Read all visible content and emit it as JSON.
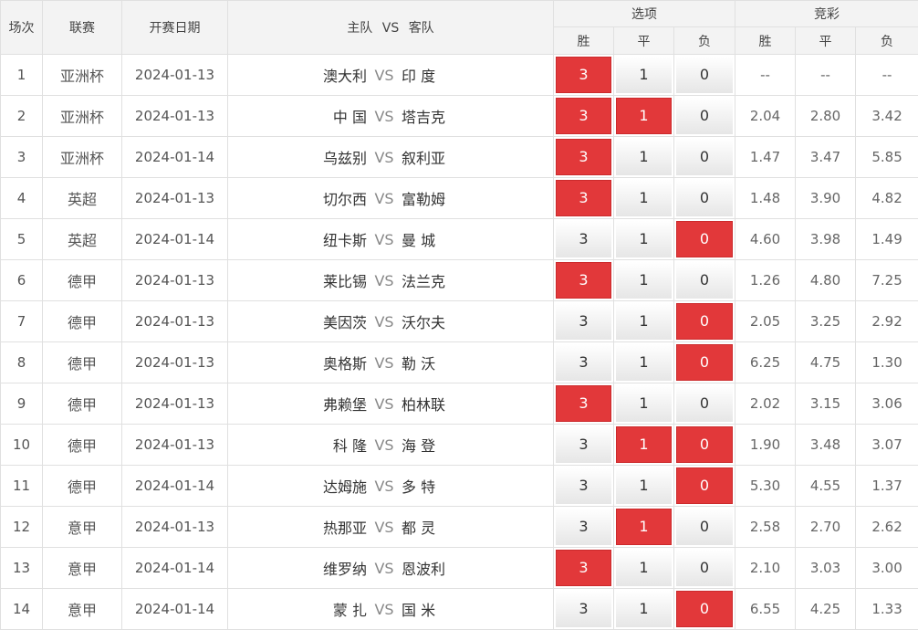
{
  "headers": {
    "round": "场次",
    "league": "联赛",
    "date": "开赛日期",
    "home": "主队",
    "vs": "VS",
    "away": "客队",
    "options": "选项",
    "lottery": "竞彩",
    "win": "胜",
    "draw": "平",
    "loss": "负"
  },
  "option_values": {
    "win": "3",
    "draw": "1",
    "loss": "0"
  },
  "colors": {
    "selected": "#e2383a",
    "header_bg": "#f3f3f3",
    "border": "#e0e0e0"
  },
  "rows": [
    {
      "no": "1",
      "league": "亚洲杯",
      "date": "2024-01-13",
      "home": "澳大利",
      "away": "印 度",
      "sel_win": true,
      "sel_draw": false,
      "sel_loss": false,
      "odds": [
        "--",
        "--",
        "--"
      ]
    },
    {
      "no": "2",
      "league": "亚洲杯",
      "date": "2024-01-13",
      "home": "中 国",
      "away": "塔吉克",
      "sel_win": true,
      "sel_draw": true,
      "sel_loss": false,
      "odds": [
        "2.04",
        "2.80",
        "3.42"
      ]
    },
    {
      "no": "3",
      "league": "亚洲杯",
      "date": "2024-01-14",
      "home": "乌兹别",
      "away": "叙利亚",
      "sel_win": true,
      "sel_draw": false,
      "sel_loss": false,
      "odds": [
        "1.47",
        "3.47",
        "5.85"
      ]
    },
    {
      "no": "4",
      "league": "英超",
      "date": "2024-01-13",
      "home": "切尔西",
      "away": "富勒姆",
      "sel_win": true,
      "sel_draw": false,
      "sel_loss": false,
      "odds": [
        "1.48",
        "3.90",
        "4.82"
      ]
    },
    {
      "no": "5",
      "league": "英超",
      "date": "2024-01-14",
      "home": "纽卡斯",
      "away": "曼 城",
      "sel_win": false,
      "sel_draw": false,
      "sel_loss": true,
      "odds": [
        "4.60",
        "3.98",
        "1.49"
      ]
    },
    {
      "no": "6",
      "league": "德甲",
      "date": "2024-01-13",
      "home": "莱比锡",
      "away": "法兰克",
      "sel_win": true,
      "sel_draw": false,
      "sel_loss": false,
      "odds": [
        "1.26",
        "4.80",
        "7.25"
      ]
    },
    {
      "no": "7",
      "league": "德甲",
      "date": "2024-01-13",
      "home": "美因茨",
      "away": "沃尔夫",
      "sel_win": false,
      "sel_draw": false,
      "sel_loss": true,
      "odds": [
        "2.05",
        "3.25",
        "2.92"
      ]
    },
    {
      "no": "8",
      "league": "德甲",
      "date": "2024-01-13",
      "home": "奥格斯",
      "away": "勒 沃",
      "sel_win": false,
      "sel_draw": false,
      "sel_loss": true,
      "odds": [
        "6.25",
        "4.75",
        "1.30"
      ]
    },
    {
      "no": "9",
      "league": "德甲",
      "date": "2024-01-13",
      "home": "弗赖堡",
      "away": "柏林联",
      "sel_win": true,
      "sel_draw": false,
      "sel_loss": false,
      "odds": [
        "2.02",
        "3.15",
        "3.06"
      ]
    },
    {
      "no": "10",
      "league": "德甲",
      "date": "2024-01-13",
      "home": "科 隆",
      "away": "海 登",
      "sel_win": false,
      "sel_draw": true,
      "sel_loss": true,
      "odds": [
        "1.90",
        "3.48",
        "3.07"
      ]
    },
    {
      "no": "11",
      "league": "德甲",
      "date": "2024-01-14",
      "home": "达姆施",
      "away": "多 特",
      "sel_win": false,
      "sel_draw": false,
      "sel_loss": true,
      "odds": [
        "5.30",
        "4.55",
        "1.37"
      ]
    },
    {
      "no": "12",
      "league": "意甲",
      "date": "2024-01-13",
      "home": "热那亚",
      "away": "都 灵",
      "sel_win": false,
      "sel_draw": true,
      "sel_loss": false,
      "odds": [
        "2.58",
        "2.70",
        "2.62"
      ]
    },
    {
      "no": "13",
      "league": "意甲",
      "date": "2024-01-14",
      "home": "维罗纳",
      "away": "恩波利",
      "sel_win": true,
      "sel_draw": false,
      "sel_loss": false,
      "odds": [
        "2.10",
        "3.03",
        "3.00"
      ]
    },
    {
      "no": "14",
      "league": "意甲",
      "date": "2024-01-14",
      "home": "蒙 扎",
      "away": "国 米",
      "sel_win": false,
      "sel_draw": false,
      "sel_loss": true,
      "odds": [
        "6.55",
        "4.25",
        "1.33"
      ]
    }
  ]
}
